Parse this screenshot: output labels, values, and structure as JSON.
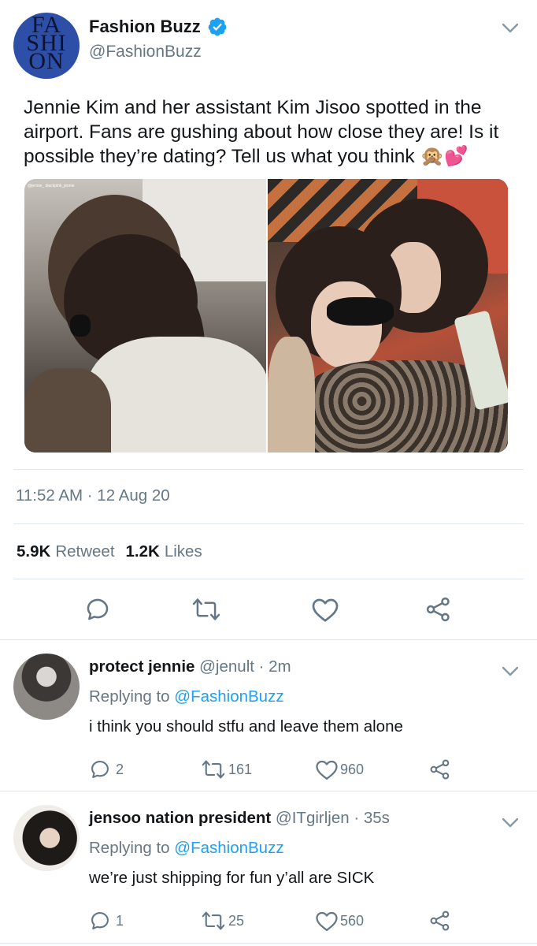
{
  "main_tweet": {
    "author_name": "Fashion Buzz",
    "author_handle": "@FashionBuzz",
    "avatar_logo_lines": [
      "FA",
      "SHI",
      "ON"
    ],
    "text": "Jennie Kim and her assistant Kim Jisoo spotted in the airport. Fans are gushing about how close they are! Is it possible they’re dating? Tell us what you think 🙊💕",
    "photo_watermark": "@jennie_  blackpink_jennie",
    "timestamp": "11:52 AM · 12 Aug 20",
    "retweets": "5.9K",
    "retweets_label": "Retweet",
    "likes": "1.2K",
    "likes_label": "Likes",
    "verified_color": "#1da1f2"
  },
  "replies": [
    {
      "name": "protect jennie",
      "meta": "@jenult · 2m",
      "replying_prefix": "Replying to ",
      "replying_to": "@FashionBuzz",
      "text": "i think you should stfu and leave them alone",
      "reply_count": "2",
      "retweet_count": "161",
      "like_count": "960"
    },
    {
      "name": "jensoo nation president",
      "meta": "@ITgirljen · 35s",
      "replying_prefix": "Replying to ",
      "replying_to": "@FashionBuzz",
      "text": "we’re just shipping for fun y’all are SICK",
      "reply_count": "1",
      "retweet_count": "25",
      "like_count": "560"
    }
  ],
  "colors": {
    "accent": "#1da1f2",
    "muted": "#657786",
    "text": "#14171a",
    "divider": "#e1e8ed"
  }
}
